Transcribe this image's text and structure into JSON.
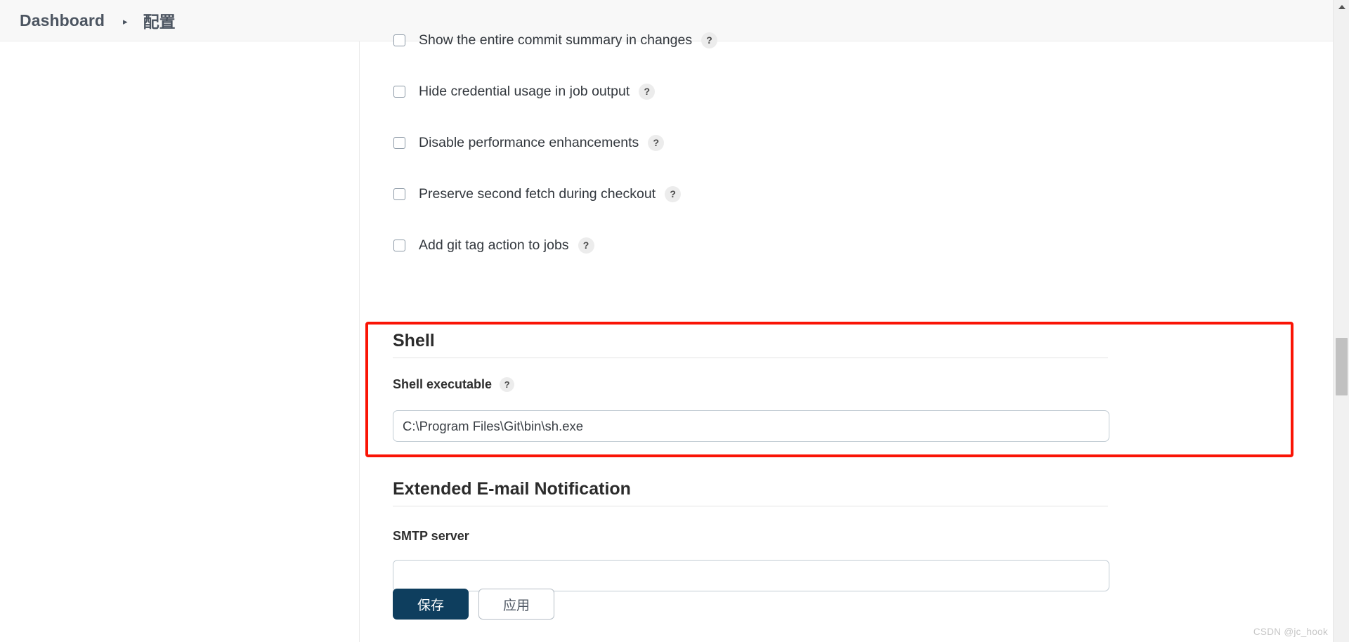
{
  "breadcrumb": {
    "home": "Dashboard",
    "separator": "▸",
    "current": "配置"
  },
  "help_icon": "?",
  "checkbox_options": [
    {
      "label": "Show the entire commit summary in changes",
      "checked": false,
      "help": "?",
      "icon": "checkbox-icon"
    },
    {
      "label": "Hide credential usage in job output",
      "checked": false,
      "help": "?",
      "icon": "checkbox-icon"
    },
    {
      "label": "Disable performance enhancements",
      "checked": false,
      "help": "?",
      "icon": "checkbox-icon"
    },
    {
      "label": "Preserve second fetch during checkout",
      "checked": false,
      "help": "?",
      "icon": "checkbox-icon"
    },
    {
      "label": "Add git tag action to jobs",
      "checked": false,
      "help": "?",
      "icon": "checkbox-icon"
    }
  ],
  "shell_section": {
    "title": "Shell",
    "field_label": "Shell executable",
    "field_help": "?",
    "field_value": "C:\\Program Files\\Git\\bin\\sh.exe",
    "field_placeholder": "",
    "highlight_color": "#fa1405"
  },
  "email_section": {
    "title": "Extended E-mail Notification",
    "field_label": "SMTP server",
    "field_value": "",
    "field_placeholder": ""
  },
  "actions": {
    "save_label": "保存",
    "apply_label": "应用",
    "save_color": "#0e3e5e"
  },
  "scrollbar": {
    "up_arrow": "▲"
  },
  "watermark": "CSDN @jc_hook"
}
